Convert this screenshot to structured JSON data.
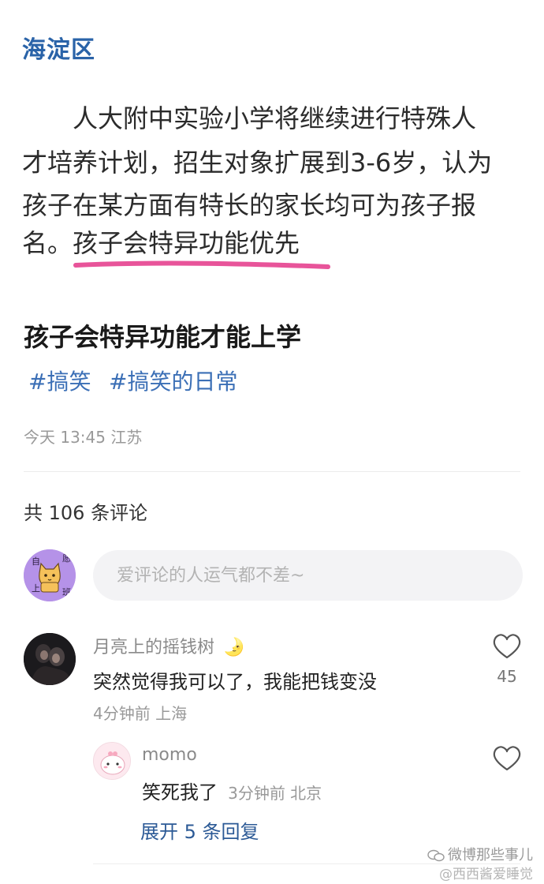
{
  "news_image": {
    "district": "海淀区",
    "lines": [
      "　　人大附中实验小学将继续进行特殊人",
      "才培养计划，招生对象扩展到3-6岁，认为",
      "孩子在某方面有特长的家长均可为孩子报",
      "名。"
    ],
    "highlighted_text": "孩子会特异功能优先",
    "underline_color": "#e8549a"
  },
  "post": {
    "title": "孩子会特异功能才能上学",
    "tags": [
      "#搞笑",
      "#搞笑的日常"
    ],
    "meta": "今天 13:45 江苏"
  },
  "comments_section": {
    "count_text": "共 106 条评论",
    "input_placeholder": "爱评论的人运气都不差~",
    "my_avatar_text": [
      "自",
      "愿",
      "上",
      "班"
    ]
  },
  "comments": [
    {
      "username": "月亮上的摇钱树",
      "username_emoji": "🌛",
      "text": "突然觉得我可以了，我能把钱变没",
      "meta": "4分钟前 上海",
      "likes": "45"
    }
  ],
  "replies": [
    {
      "username": "momo",
      "text": "笑死我了",
      "meta": "3分钟前 北京"
    }
  ],
  "expand_replies": "展开 5 条回复",
  "watermark": {
    "line1": "微博那些事儿",
    "line2": "@西西酱爱睡觉"
  },
  "colors": {
    "tag_blue": "#3b6fb6",
    "district_blue": "#2a63a8",
    "highlight_pink": "#e8549a"
  }
}
